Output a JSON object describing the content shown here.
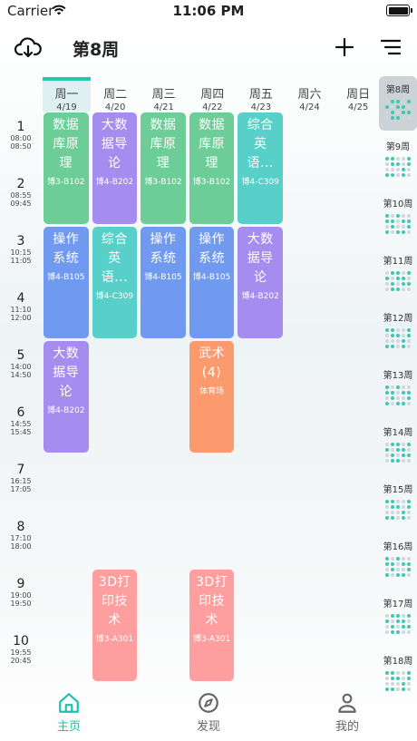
{
  "status_bar": {
    "carrier": "Carrier",
    "time": "11:06 PM"
  },
  "header": {
    "title": "第8周",
    "icons": [
      "cloud-download-icon",
      "plus-icon",
      "menu-icon"
    ]
  },
  "days": [
    {
      "name": "周一",
      "date": "4/19"
    },
    {
      "name": "周二",
      "date": "4/20"
    },
    {
      "name": "周三",
      "date": "4/21"
    },
    {
      "name": "周四",
      "date": "4/22"
    },
    {
      "name": "周五",
      "date": "4/23"
    },
    {
      "name": "周六",
      "date": "4/24"
    },
    {
      "name": "周日",
      "date": "4/25"
    }
  ],
  "periods": [
    {
      "num": "1",
      "start": "08:00",
      "end": "08:50"
    },
    {
      "num": "2",
      "start": "08:55",
      "end": "09:45"
    },
    {
      "num": "3",
      "start": "10:15",
      "end": "11:05"
    },
    {
      "num": "4",
      "start": "11:10",
      "end": "12:00"
    },
    {
      "num": "5",
      "start": "14:00",
      "end": "14:50"
    },
    {
      "num": "6",
      "start": "14:55",
      "end": "15:45"
    },
    {
      "num": "7",
      "start": "16:15",
      "end": "17:05"
    },
    {
      "num": "8",
      "start": "17:10",
      "end": "18:00"
    },
    {
      "num": "9",
      "start": "19:00",
      "end": "19:50"
    },
    {
      "num": "10",
      "start": "19:55",
      "end": "20:45"
    }
  ],
  "courses": [
    {
      "name": "数据库原理",
      "room": "博3-B102",
      "day": 1,
      "start": 1,
      "span": 2,
      "color": "#6dcd96"
    },
    {
      "name": "大数据导论",
      "room": "博4-B202",
      "day": 2,
      "start": 1,
      "span": 2,
      "color": "#a58cef"
    },
    {
      "name": "数据库原理",
      "room": "博3-B102",
      "day": 3,
      "start": 1,
      "span": 2,
      "color": "#6dcd96"
    },
    {
      "name": "数据库原理",
      "room": "博3-B102",
      "day": 4,
      "start": 1,
      "span": 2,
      "color": "#6dcd96"
    },
    {
      "name": "综合英语...",
      "room": "博4-C309",
      "day": 5,
      "start": 1,
      "span": 2,
      "color": "#58cfc8"
    },
    {
      "name": "操作系统",
      "room": "博4-B105",
      "day": 1,
      "start": 3,
      "span": 2,
      "color": "#6f9af0"
    },
    {
      "name": "综合英语...",
      "room": "博4-C309",
      "day": 2,
      "start": 3,
      "span": 2,
      "color": "#58cfc8"
    },
    {
      "name": "操作系统",
      "room": "博4-B105",
      "day": 3,
      "start": 3,
      "span": 2,
      "color": "#6f9af0"
    },
    {
      "name": "操作系统",
      "room": "博4-B105",
      "day": 4,
      "start": 3,
      "span": 2,
      "color": "#6f9af0"
    },
    {
      "name": "大数据导论",
      "room": "博4-B202",
      "day": 5,
      "start": 3,
      "span": 2,
      "color": "#a58cef"
    },
    {
      "name": "大数据导论",
      "room": "博4-B202",
      "day": 1,
      "start": 5,
      "span": 2,
      "color": "#a58cef"
    },
    {
      "name": "武术(4)",
      "room": "体育场",
      "day": 4,
      "start": 5,
      "span": 2,
      "color": "#fb9a6c"
    },
    {
      "name": "3D打印技术",
      "room": "博3-A301",
      "day": 2,
      "start": 9,
      "span": 2,
      "color": "#ff9e9e"
    },
    {
      "name": "3D打印技术",
      "room": "博3-A301",
      "day": 4,
      "start": 9,
      "span": 2,
      "color": "#ff9e9e"
    }
  ],
  "weeks": [
    {
      "label": "第8周",
      "selected": true
    },
    {
      "label": "第9周",
      "selected": false
    },
    {
      "label": "第10周",
      "selected": false
    },
    {
      "label": "第11周",
      "selected": false
    },
    {
      "label": "第12周",
      "selected": false
    },
    {
      "label": "第13周",
      "selected": false
    },
    {
      "label": "第14周",
      "selected": false
    },
    {
      "label": "第15周",
      "selected": false
    },
    {
      "label": "第16周",
      "selected": false
    },
    {
      "label": "第17周",
      "selected": false
    },
    {
      "label": "第18周",
      "selected": false
    }
  ],
  "tabbar": [
    {
      "label": "主页",
      "icon": "home-icon",
      "active": true,
      "color": "#18c2ad"
    },
    {
      "label": "发现",
      "icon": "compass-icon",
      "active": false,
      "color": "#666666"
    },
    {
      "label": "我的",
      "icon": "user-icon",
      "active": false,
      "color": "#666666"
    }
  ]
}
